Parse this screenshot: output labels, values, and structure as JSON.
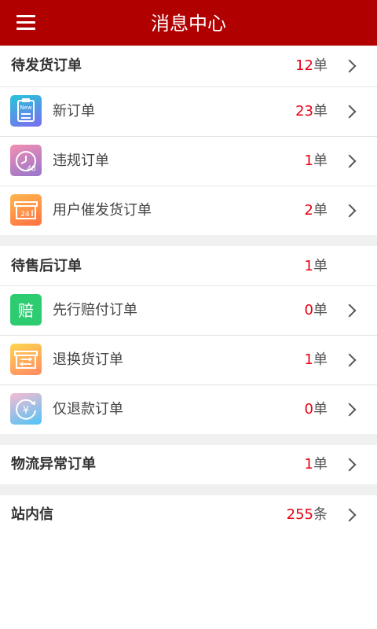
{
  "header": {
    "title": "消息中心",
    "menu_icon": "menu-icon"
  },
  "sections": {
    "pending_shipment": {
      "label": "待发货订单",
      "count": "12",
      "unit": "单",
      "items": [
        {
          "label": "新订单",
          "count": "23",
          "unit": "单",
          "icon": "new-order-icon",
          "icon_text": "New"
        },
        {
          "label": "违规订单",
          "count": "1",
          "unit": "单",
          "icon": "timer-48-icon",
          "icon_text": "48"
        },
        {
          "label": "用户催发货订单",
          "count": "2",
          "unit": "单",
          "icon": "box-24h-icon",
          "icon_text": "24"
        }
      ]
    },
    "after_sales": {
      "label": "待售后订单",
      "count": "1",
      "unit": "单",
      "items": [
        {
          "label": "先行赔付订单",
          "count": "0",
          "unit": "单",
          "icon": "compensation-icon",
          "icon_text": "赔"
        },
        {
          "label": "退换货订单",
          "count": "1",
          "unit": "单",
          "icon": "exchange-box-icon"
        },
        {
          "label": "仅退款订单",
          "count": "0",
          "unit": "单",
          "icon": "refund-yen-icon",
          "icon_text": "¥"
        }
      ]
    },
    "logistics": {
      "label": "物流异常订单",
      "count": "1",
      "unit": "单"
    },
    "inbox": {
      "label": "站内信",
      "count": "255",
      "unit": "条"
    }
  },
  "colors": {
    "header_bg": "#b10000",
    "count_red": "#e60012",
    "new_order_icon": [
      "#26c6da",
      "#7c6cf0"
    ],
    "violation_icon": [
      "#f48fb1",
      "#9575cd"
    ],
    "urge_icon": [
      "#ffb74d",
      "#ff7043"
    ],
    "compensation_icon": "#2ecc71",
    "exchange_icon": [
      "#ffd54f",
      "#ff8a65"
    ],
    "refund_icon": [
      "#f8bbd0",
      "#4fc3f7"
    ]
  }
}
